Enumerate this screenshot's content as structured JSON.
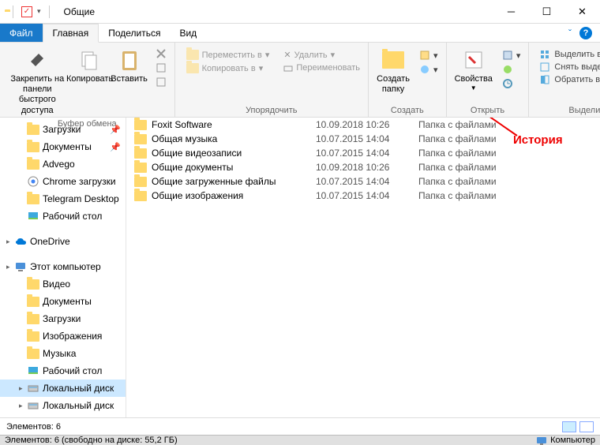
{
  "title": "Общие",
  "tabs": {
    "file": "Файл",
    "home": "Главная",
    "share": "Поделиться",
    "view": "Вид"
  },
  "ribbon": {
    "clipboard": {
      "pin": "Закрепить на панели\nбыстрого доступа",
      "copy": "Копировать",
      "paste": "Вставить",
      "label": "Буфер обмена"
    },
    "organize": {
      "move": "Переместить в",
      "copyTo": "Копировать в",
      "delete": "Удалить",
      "rename": "Переименовать",
      "label": "Упорядочить"
    },
    "create": {
      "newFolder": "Создать\nпапку",
      "label": "Создать"
    },
    "open": {
      "props": "Свойства",
      "label": "Открыть"
    },
    "select": {
      "all": "Выделить все",
      "none": "Снять выделение",
      "invert": "Обратить выделение",
      "label": "Выделить"
    }
  },
  "nav": [
    {
      "icon": "folder",
      "label": "Загрузки",
      "pin": true,
      "level": 2
    },
    {
      "icon": "folder",
      "label": "Документы",
      "pin": true,
      "level": 2
    },
    {
      "icon": "folder",
      "label": "Advego",
      "pin": false,
      "level": 2
    },
    {
      "icon": "chrome",
      "label": "Chrome загрузки",
      "pin": false,
      "level": 2
    },
    {
      "icon": "folder",
      "label": "Telegram Desktop",
      "pin": false,
      "level": 2
    },
    {
      "icon": "desktop",
      "label": "Рабочий стол",
      "pin": false,
      "level": 2
    },
    {
      "icon": "spacer",
      "label": "",
      "level": 0
    },
    {
      "icon": "onedrive",
      "label": "OneDrive",
      "level": 1,
      "arrow": true
    },
    {
      "icon": "spacer",
      "label": "",
      "level": 0
    },
    {
      "icon": "pc",
      "label": "Этот компьютер",
      "level": 1,
      "arrow": true
    },
    {
      "icon": "video",
      "label": "Видео",
      "level": 2
    },
    {
      "icon": "docs",
      "label": "Документы",
      "level": 2
    },
    {
      "icon": "download",
      "label": "Загрузки",
      "level": 2
    },
    {
      "icon": "images",
      "label": "Изображения",
      "level": 2
    },
    {
      "icon": "music",
      "label": "Музыка",
      "level": 2
    },
    {
      "icon": "desktop",
      "label": "Рабочий стол",
      "level": 2
    },
    {
      "icon": "disk",
      "label": "Локальный диск",
      "level": 2,
      "arrow": true,
      "selected": true
    },
    {
      "icon": "disk",
      "label": "Локальный диск",
      "level": 2,
      "arrow": true
    }
  ],
  "files": [
    {
      "name": "Foxit Software",
      "date": "10.09.2018 10:26",
      "type": "Папка с файлами"
    },
    {
      "name": "Общая музыка",
      "date": "10.07.2015 14:04",
      "type": "Папка с файлами"
    },
    {
      "name": "Общие видеозаписи",
      "date": "10.07.2015 14:04",
      "type": "Папка с файлами"
    },
    {
      "name": "Общие документы",
      "date": "10.09.2018 10:26",
      "type": "Папка с файлами"
    },
    {
      "name": "Общие загруженные файлы",
      "date": "10.07.2015 14:04",
      "type": "Папка с файлами"
    },
    {
      "name": "Общие изображения",
      "date": "10.07.2015 14:04",
      "type": "Папка с файлами"
    }
  ],
  "status": "Элементов: 6",
  "taskbar": {
    "left": "Элементов: 6 (свободно на диске: 55,2 ГБ)",
    "right": "Компьютер"
  },
  "annotation": "История"
}
